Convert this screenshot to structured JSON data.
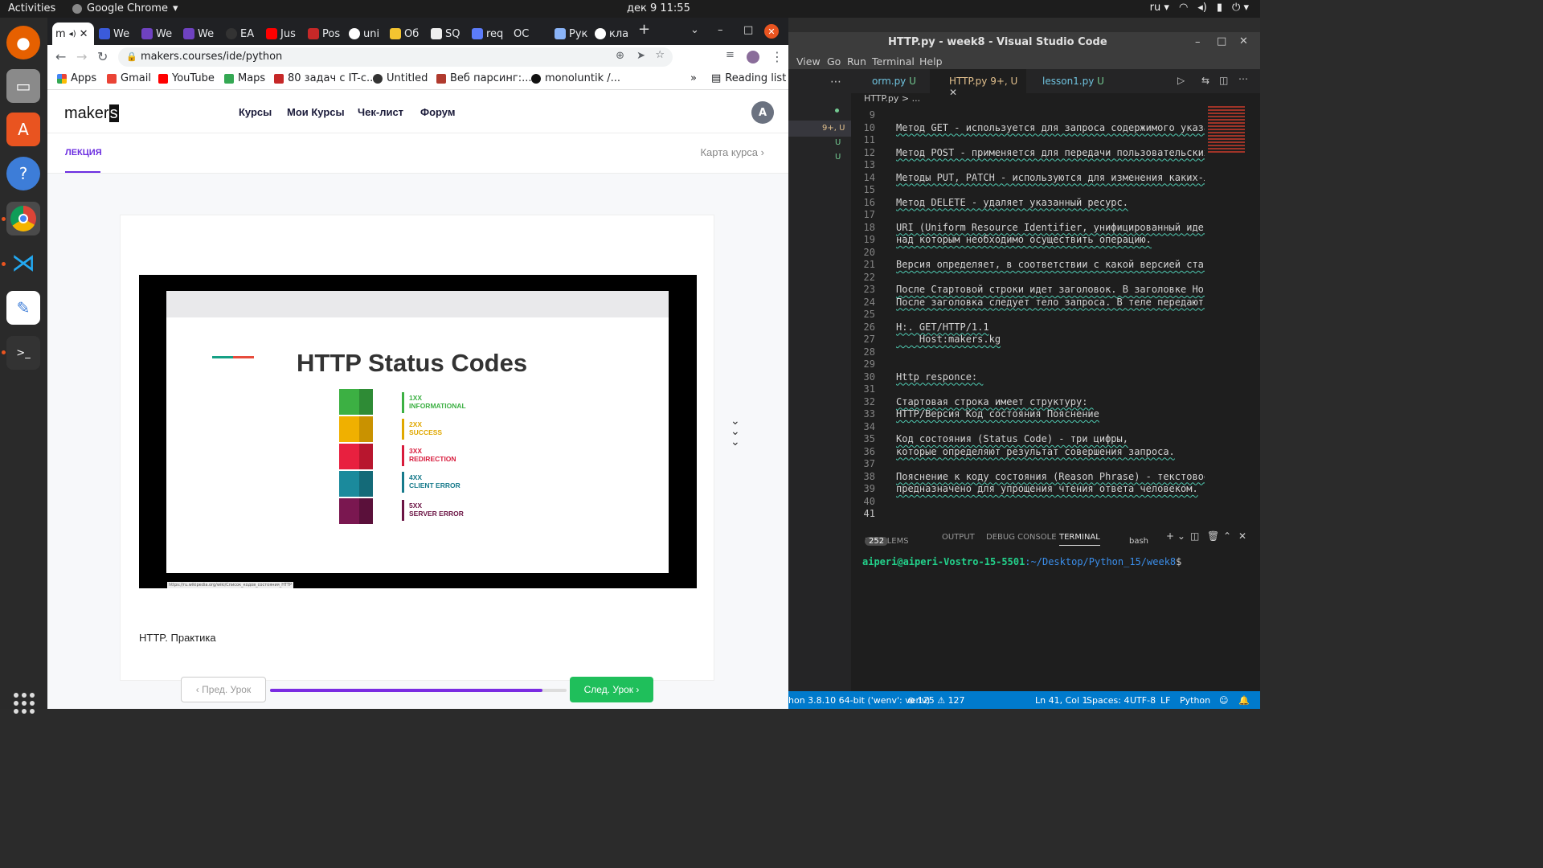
{
  "topbar": {
    "activities": "Activities",
    "app": "Google Chrome",
    "clock": "дек 9  11:55",
    "lang": "ru"
  },
  "chrome": {
    "tabs": [
      {
        "label": "m",
        "icon": "makers-favicon"
      },
      {
        "label": "We"
      },
      {
        "label": "We"
      },
      {
        "label": "We"
      },
      {
        "label": "EA"
      },
      {
        "label": "Jus"
      },
      {
        "label": "Pos"
      },
      {
        "label": "uni"
      },
      {
        "label": "Об"
      },
      {
        "label": "SQ"
      },
      {
        "label": "req"
      },
      {
        "label": "ОС"
      },
      {
        "label": "Рук"
      },
      {
        "label": "кла"
      }
    ],
    "url": "makers.courses/ide/python",
    "bookmarks": [
      "Apps",
      "Gmail",
      "YouTube",
      "Maps",
      "80 задач с IT-с...",
      "Untitled",
      "Веб парсинг:...",
      "monoluntik /...",
      "Reading list"
    ]
  },
  "site": {
    "logo_text": "maker",
    "logo_last": "s",
    "nav": [
      "Курсы",
      "Мои Курсы",
      "Чек-лист",
      "Форум"
    ],
    "avatar": "A",
    "lecture_tab": "ЛЕКЦИЯ",
    "course_map": "Карта курса",
    "slide": {
      "title": "HTTP Status Codes",
      "codes": [
        {
          "num": "1XX",
          "name": "INFORMATIONAL",
          "color": "#3cb043"
        },
        {
          "num": "2XX",
          "name": "SUCCESS",
          "color": "#e0a800"
        },
        {
          "num": "3XX",
          "name": "REDIRECTION",
          "color": "#d81b3c"
        },
        {
          "num": "4XX",
          "name": "CLIENT ERROR",
          "color": "#167a8b"
        },
        {
          "num": "5XX",
          "name": "SERVER ERROR",
          "color": "#6b1444"
        }
      ],
      "source": "https://ru.wikipedia.org/wiki/Список_кодов_состояния_HTTP"
    },
    "practice": "HTTP. Практика",
    "prev_label": "Пред. Урок",
    "next_label": "След. Урок",
    "progress": 0.92
  },
  "vscode": {
    "title": "HTTP.py - week8 - Visual Studio Code",
    "menu": [
      "View",
      "Go",
      "Run",
      "Terminal",
      "Help"
    ],
    "tabs": [
      {
        "name": "orm.py",
        "status": "U"
      },
      {
        "name": "HTTP.py",
        "status": "9+, U"
      },
      {
        "name": "lesson1.py",
        "status": "U"
      }
    ],
    "breadcrumb": "HTTP.py > ...",
    "lines": [
      {
        "n": "9",
        "t": ""
      },
      {
        "n": "10",
        "t": "Метод GET - используется для запроса содержимого указанн"
      },
      {
        "n": "11",
        "t": ""
      },
      {
        "n": "12",
        "t": "Метод POST - применяется для передачи пользовательских д"
      },
      {
        "n": "13",
        "t": ""
      },
      {
        "n": "14",
        "t": "Методы PUT, PATCH - используются для изменения каких-ли("
      },
      {
        "n": "15",
        "t": ""
      },
      {
        "n": "16",
        "t": "Метод DELETE - удаляет указанный ресурс."
      },
      {
        "n": "17",
        "t": ""
      },
      {
        "n": "18",
        "t": "URI (Uniform Resource Identifier, унифицированный иденти"
      },
      {
        "n": "19",
        "t": "над которым необходимо осуществить операцию."
      },
      {
        "n": "20",
        "t": ""
      },
      {
        "n": "21",
        "t": "Версия определяет, в соответствии с какой версией станда"
      },
      {
        "n": "22",
        "t": ""
      },
      {
        "n": "23",
        "t": "После Стартовой строки идет заголовок. В заголовке Host"
      },
      {
        "n": "24",
        "t": "После заголовка следует тело запроса. В теле передаются"
      },
      {
        "n": "25",
        "t": ""
      },
      {
        "n": "26",
        "t": "H:. GET/HTTP/1.1"
      },
      {
        "n": "27",
        "t": "    Host:makers.kg"
      },
      {
        "n": "28",
        "t": ""
      },
      {
        "n": "29",
        "t": ""
      },
      {
        "n": "30",
        "t": "Http responce: "
      },
      {
        "n": "31",
        "t": ""
      },
      {
        "n": "32",
        "t": "Стартовая строка имеет структуру: "
      },
      {
        "n": "33",
        "t": "HTTP/Версия Код состояния Пояснение"
      },
      {
        "n": "34",
        "t": ""
      },
      {
        "n": "35",
        "t": "Код состояния (Status Code) - три цифры,"
      },
      {
        "n": "36",
        "t": "которые определяют результат совершения запроса."
      },
      {
        "n": "37",
        "t": ""
      },
      {
        "n": "38",
        "t": "Пояснение к коду состояния (Reason Phrase) - текстовое п"
      },
      {
        "n": "39",
        "t": "предназначено для упрощения чтения ответа человеком."
      },
      {
        "n": "40",
        "t": ""
      },
      {
        "n": "41",
        "t": ""
      }
    ],
    "panel_tabs": [
      "PROBLEMS",
      "OUTPUT",
      "DEBUG CONSOLE",
      "TERMINAL"
    ],
    "problems_count": "252",
    "shell": "bash",
    "prompt_user": "aiperi@aiperi-Vostro-15-5501",
    "prompt_path": ":~/Desktop/Python_15/week8",
    "prompt_end": "$",
    "status": {
      "python": "hon 3.8.10 64-bit ('wenv': venv)",
      "counts": "⊗ 125 ⚠ 127",
      "pos": "Ln 41, Col 1",
      "spaces": "Spaces: 4",
      "enc": "UTF-8",
      "eol": "LF",
      "lang": "Python"
    }
  }
}
